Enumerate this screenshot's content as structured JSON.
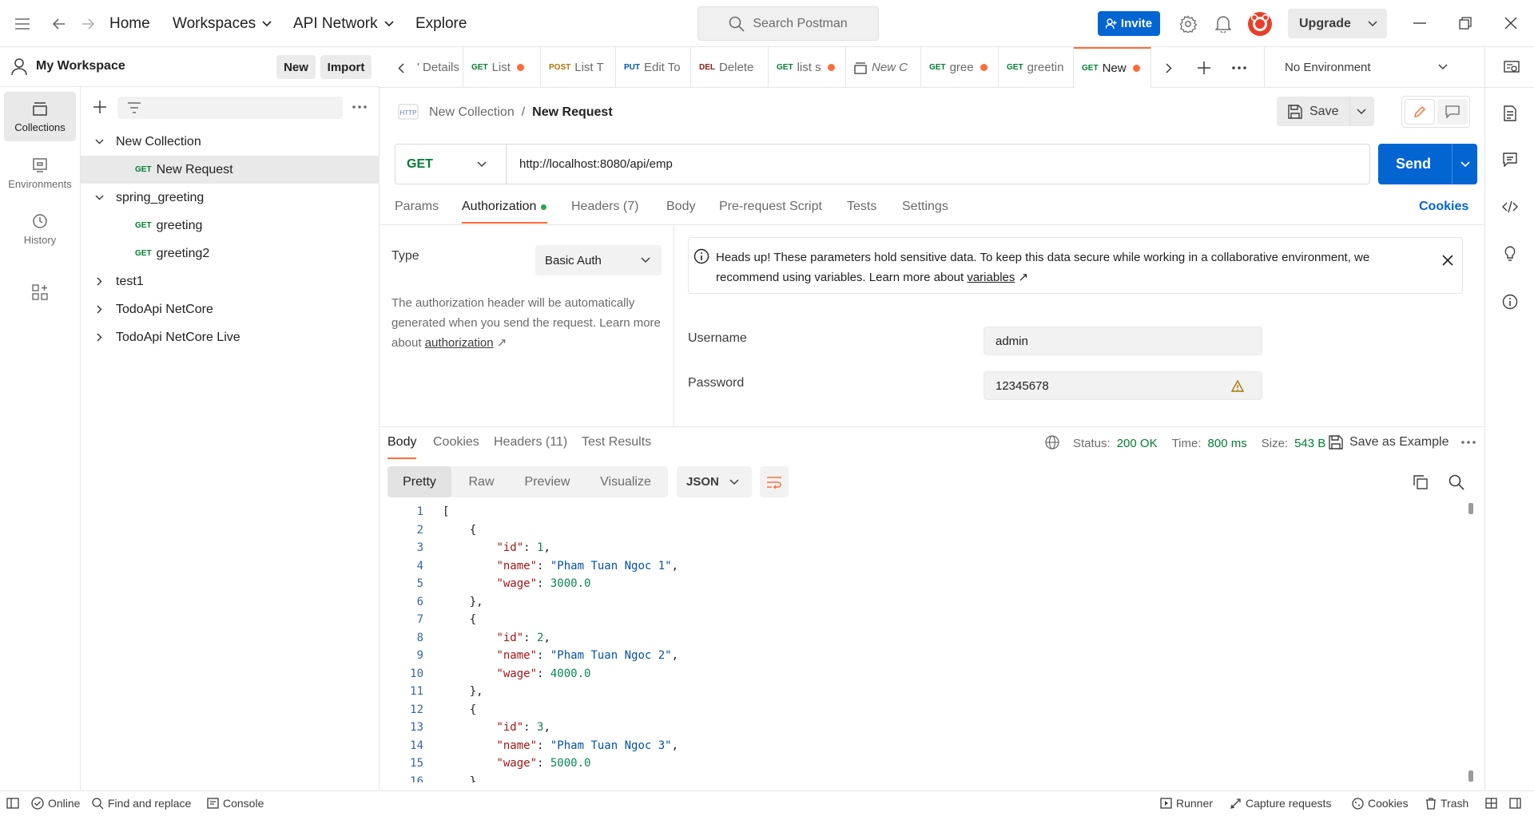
{
  "topbar": {
    "nav": [
      "Home",
      "Workspaces",
      "API Network",
      "Explore"
    ],
    "search_placeholder": "Search Postman",
    "invite": "Invite",
    "upgrade": "Upgrade"
  },
  "rail": {
    "items": [
      {
        "label": "Collections",
        "icon": "collections-icon"
      },
      {
        "label": "Environments",
        "icon": "environments-icon"
      },
      {
        "label": "History",
        "icon": "history-icon"
      }
    ]
  },
  "sidebar": {
    "workspace": "My Workspace",
    "new_label": "New",
    "import_label": "Import",
    "tree": [
      {
        "type": "collection",
        "label": "New Collection",
        "expanded": true
      },
      {
        "type": "request",
        "method": "GET",
        "label": "New Request",
        "selected": true
      },
      {
        "type": "collection",
        "label": "spring_greeting",
        "expanded": true
      },
      {
        "type": "request",
        "method": "GET",
        "label": "greeting"
      },
      {
        "type": "request",
        "method": "GET",
        "label": "greeting2"
      },
      {
        "type": "collection",
        "label": "test1",
        "expanded": false
      },
      {
        "type": "collection",
        "label": "TodoApi NetCore",
        "expanded": false
      },
      {
        "type": "collection",
        "label": "TodoApi NetCore Live",
        "expanded": false
      }
    ]
  },
  "tabs": [
    {
      "method": "",
      "label": "' Details",
      "dot": false
    },
    {
      "method": "GET",
      "label": "List",
      "dot": true
    },
    {
      "method": "POST",
      "label": "List T",
      "dot": false
    },
    {
      "method": "PUT",
      "label": "Edit To",
      "dot": false
    },
    {
      "method": "DEL",
      "label": "Delete",
      "dot": false
    },
    {
      "method": "GET",
      "label": "list s",
      "dot": true
    },
    {
      "method": "",
      "label": "New C",
      "dot": false
    },
    {
      "method": "GET",
      "label": "gree",
      "dot": true
    },
    {
      "method": "GET",
      "label": "greetin",
      "dot": false
    },
    {
      "method": "GET",
      "label": "New",
      "dot": true
    }
  ],
  "environment": "No Environment",
  "request": {
    "breadcrumb_collection": "New Collection",
    "breadcrumb_sep": "/",
    "name": "New Request",
    "save": "Save",
    "method": "GET",
    "url": "http://localhost:8080/api/emp",
    "send": "Send",
    "tabs": [
      "Params",
      "Authorization",
      "Headers (7)",
      "Body",
      "Pre-request Script",
      "Tests",
      "Settings"
    ],
    "active_tab": "Authorization",
    "cookies": "Cookies"
  },
  "auth": {
    "type_label": "Type",
    "type_value": "Basic Auth",
    "desc": "The authorization header will be automatically generated when you send the request. Learn more about ",
    "desc_link": "authorization",
    "banner_text": "Heads up! These parameters hold sensitive data. To keep this data secure while working in a collaborative environment, we recommend using variables. Learn more about ",
    "banner_link": "variables",
    "username_label": "Username",
    "username": "admin",
    "password_label": "Password",
    "password": "12345678"
  },
  "response": {
    "tabs": [
      "Body",
      "Cookies",
      "Headers (11)",
      "Test Results"
    ],
    "status_label": "Status:",
    "status": "200 OK",
    "time_label": "Time:",
    "time": "800 ms",
    "size_label": "Size:",
    "size": "543 B",
    "save_example": "Save as Example",
    "views": [
      "Pretty",
      "Raw",
      "Preview",
      "Visualize"
    ],
    "format": "JSON",
    "code_lines": [
      [
        {
          "t": "[",
          "c": "p"
        }
      ],
      [
        {
          "t": "    {",
          "c": "p"
        }
      ],
      [
        {
          "t": "        ",
          "c": "p"
        },
        {
          "t": "\"id\"",
          "c": "k"
        },
        {
          "t": ": ",
          "c": "p"
        },
        {
          "t": "1",
          "c": "n"
        },
        {
          "t": ",",
          "c": "p"
        }
      ],
      [
        {
          "t": "        ",
          "c": "p"
        },
        {
          "t": "\"name\"",
          "c": "k"
        },
        {
          "t": ": ",
          "c": "p"
        },
        {
          "t": "\"Pham Tuan Ngoc 1\"",
          "c": "s"
        },
        {
          "t": ",",
          "c": "p"
        }
      ],
      [
        {
          "t": "        ",
          "c": "p"
        },
        {
          "t": "\"wage\"",
          "c": "k"
        },
        {
          "t": ": ",
          "c": "p"
        },
        {
          "t": "3000.0",
          "c": "n"
        }
      ],
      [
        {
          "t": "    },",
          "c": "p"
        }
      ],
      [
        {
          "t": "    {",
          "c": "p"
        }
      ],
      [
        {
          "t": "        ",
          "c": "p"
        },
        {
          "t": "\"id\"",
          "c": "k"
        },
        {
          "t": ": ",
          "c": "p"
        },
        {
          "t": "2",
          "c": "n"
        },
        {
          "t": ",",
          "c": "p"
        }
      ],
      [
        {
          "t": "        ",
          "c": "p"
        },
        {
          "t": "\"name\"",
          "c": "k"
        },
        {
          "t": ": ",
          "c": "p"
        },
        {
          "t": "\"Pham Tuan Ngoc 2\"",
          "c": "s"
        },
        {
          "t": ",",
          "c": "p"
        }
      ],
      [
        {
          "t": "        ",
          "c": "p"
        },
        {
          "t": "\"wage\"",
          "c": "k"
        },
        {
          "t": ": ",
          "c": "p"
        },
        {
          "t": "4000.0",
          "c": "n"
        }
      ],
      [
        {
          "t": "    },",
          "c": "p"
        }
      ],
      [
        {
          "t": "    {",
          "c": "p"
        }
      ],
      [
        {
          "t": "        ",
          "c": "p"
        },
        {
          "t": "\"id\"",
          "c": "k"
        },
        {
          "t": ": ",
          "c": "p"
        },
        {
          "t": "3",
          "c": "n"
        },
        {
          "t": ",",
          "c": "p"
        }
      ],
      [
        {
          "t": "        ",
          "c": "p"
        },
        {
          "t": "\"name\"",
          "c": "k"
        },
        {
          "t": ": ",
          "c": "p"
        },
        {
          "t": "\"Pham Tuan Ngoc 3\"",
          "c": "s"
        },
        {
          "t": ",",
          "c": "p"
        }
      ],
      [
        {
          "t": "        ",
          "c": "p"
        },
        {
          "t": "\"wage\"",
          "c": "k"
        },
        {
          "t": ": ",
          "c": "p"
        },
        {
          "t": "5000.0",
          "c": "n"
        }
      ],
      [
        {
          "t": "    }",
          "c": "p"
        }
      ]
    ]
  },
  "statusbar": {
    "online": "Online",
    "find_replace": "Find and replace",
    "console": "Console",
    "runner": "Runner",
    "capture": "Capture requests",
    "cookies": "Cookies",
    "trash": "Trash"
  },
  "colors": {
    "accent": "#ff6c37",
    "primary": "#0265d2",
    "get": "#007f31",
    "status_ok": "#007f31"
  }
}
